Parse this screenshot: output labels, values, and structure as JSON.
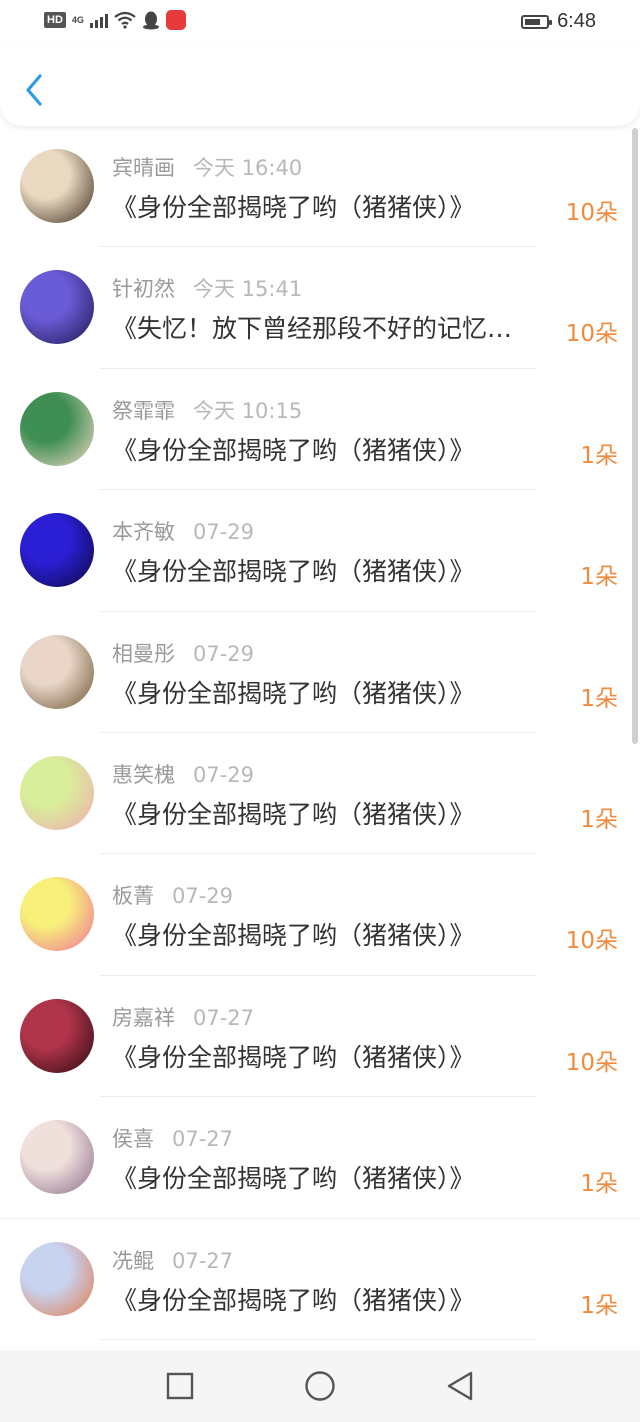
{
  "status_bar": {
    "hd": "HD",
    "network": "4G",
    "time": "6:48",
    "icons": [
      "hd-icon",
      "signal-icon",
      "wifi-icon",
      "qq-icon",
      "app-notification-icon",
      "battery-icon"
    ],
    "battery_level": 0.75
  },
  "header": {
    "back_icon": "chevron-left-icon",
    "accent": "#2e9be6"
  },
  "accent_color": "#f08a3c",
  "list": [
    {
      "name": "宾晴画",
      "date": "今天 16:40",
      "title": "《身份全部揭晓了哟（猪猪侠）》",
      "count": "10朵",
      "avatar_colors": [
        "#e8d9c0",
        "#3a2a1c"
      ]
    },
    {
      "name": "针初然",
      "date": "今天 15:41",
      "title": "《失忆！放下曾经那段不好的记忆…",
      "count": "10朵",
      "avatar_colors": [
        "#6a5bd6",
        "#1c1850"
      ]
    },
    {
      "name": "祭霏霏",
      "date": "今天 10:15",
      "title": "《身份全部揭晓了哟（猪猪侠）》",
      "count": "1朵",
      "avatar_colors": [
        "#3f8f54",
        "#f3d9c8"
      ]
    },
    {
      "name": "本齐敏",
      "date": "07-29",
      "title": "《身份全部揭晓了哟（猪猪侠）》",
      "count": "1朵",
      "avatar_colors": [
        "#2b1fd6",
        "#0b0840"
      ]
    },
    {
      "name": "相曼彤",
      "date": "07-29",
      "title": "《身份全部揭晓了哟（猪猪侠）》",
      "count": "1朵",
      "avatar_colors": [
        "#e9d6c8",
        "#6b5530"
      ]
    },
    {
      "name": "惠笑槐",
      "date": "07-29",
      "title": "《身份全部揭晓了哟（猪猪侠）》",
      "count": "1朵",
      "avatar_colors": [
        "#d9ee9a",
        "#f2a9b0"
      ]
    },
    {
      "name": "板菁",
      "date": "07-29",
      "title": "《身份全部揭晓了哟（猪猪侠）》",
      "count": "10朵",
      "avatar_colors": [
        "#f7f07a",
        "#f06f9a"
      ]
    },
    {
      "name": "房嘉祥",
      "date": "07-27",
      "title": "《身份全部揭晓了哟（猪猪侠）》",
      "count": "10朵",
      "avatar_colors": [
        "#b0344a",
        "#2a0a12"
      ]
    },
    {
      "name": "侯喜",
      "date": "07-27",
      "title": "《身份全部揭晓了哟（猪猪侠）》",
      "count": "1朵",
      "avatar_colors": [
        "#f0e0dc",
        "#8a6a8a"
      ]
    },
    {
      "name": "冼鲲",
      "date": "07-27",
      "title": "《身份全部揭晓了哟（猪猪侠）》",
      "count": "1朵",
      "avatar_colors": [
        "#c8d3f0",
        "#e07a4a"
      ]
    }
  ],
  "nav_bar": {
    "icons": [
      "recents-square-icon",
      "home-circle-icon",
      "back-triangle-icon"
    ]
  }
}
